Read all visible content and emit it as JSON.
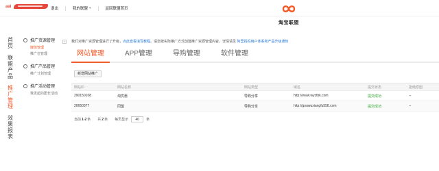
{
  "topbar": {
    "logo_text": "aai",
    "nav": [
      {
        "label": "退出"
      },
      {
        "label": "我的联盟"
      },
      {
        "label": "返回联盟首页"
      }
    ],
    "caret": "▾"
  },
  "brand": {
    "name": "淘宝联盟",
    "accent": "#f25a29"
  },
  "leftnav": {
    "items": [
      {
        "label": "首页"
      },
      {
        "label": "联盟产品"
      },
      {
        "label": "推广管理"
      },
      {
        "label": "效果报表"
      }
    ]
  },
  "sidebar": {
    "collapse_glyph": "‹",
    "groups": [
      {
        "title": "推广资源管理",
        "icon": "globe-icon",
        "items": [
          "媒体管理",
          "推广位管理"
        ]
      },
      {
        "title": "推广产品管理",
        "icon": "box-icon",
        "items": [
          "推广计划管理"
        ]
      },
      {
        "title": "推广活动管理",
        "icon": "flag-icon",
        "items": [
          "我发起的团长活动"
        ]
      }
    ]
  },
  "notice": {
    "text": "我们对推广资源管理进行了升级，",
    "link1": "点此查看填写教程",
    "text2": "。请您按实际推广方式创建推广资源管理内容，详情请见",
    "link2": "阿里妈妈用户体系和产品升级通知"
  },
  "tabs": [
    {
      "label": "网站管理"
    },
    {
      "label": "APP管理"
    },
    {
      "label": "导购管理"
    },
    {
      "label": "软件管理"
    }
  ],
  "add_button": "新增网站推广",
  "table": {
    "columns": [
      "网站ID",
      "网站名称",
      "网站类型",
      "域名",
      "提交状态",
      "拒绝原因"
    ],
    "rows": [
      {
        "id": "290150108",
        "name": "淘优惠",
        "type": "导购分享",
        "domain": "http://www.wyztbk.com",
        "status": "提交成功",
        "reason": "--"
      },
      {
        "id": "20650377",
        "name": "同盟",
        "type": "导购分享",
        "domain": "http://gouwuxiangfu558.com",
        "status": "提交成功",
        "reason": "--"
      }
    ]
  },
  "pager": {
    "prefix": "当前",
    "range": "1-2",
    "mid": "条",
    "total_prefix": "共",
    "total": "2",
    "total_suffix": "条",
    "per_page_label": "每页显示",
    "per_page": "40",
    "per_page_suffix": "条"
  }
}
